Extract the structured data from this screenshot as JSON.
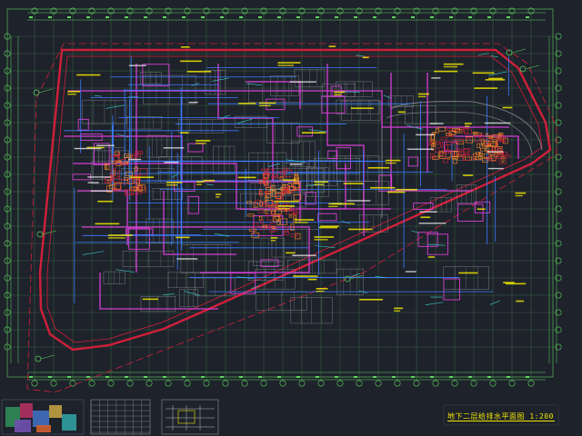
{
  "drawing": {
    "sheet_title": "地下二层给排水平面图 1:200",
    "colors": {
      "background": "#1e222b",
      "boundary_red": "#d0203a",
      "column_grid": "#5fd35f",
      "wall_magenta": "#d43fd4",
      "pipe_blue": "#3b7cff",
      "structure_grey": "#8c8f96",
      "annotation_yellow": "#f2e600",
      "equipment_orange": "#ff8a2a",
      "dimension_cyan": "#39d0d0"
    },
    "icons": [
      "north-arrow-icon"
    ]
  }
}
